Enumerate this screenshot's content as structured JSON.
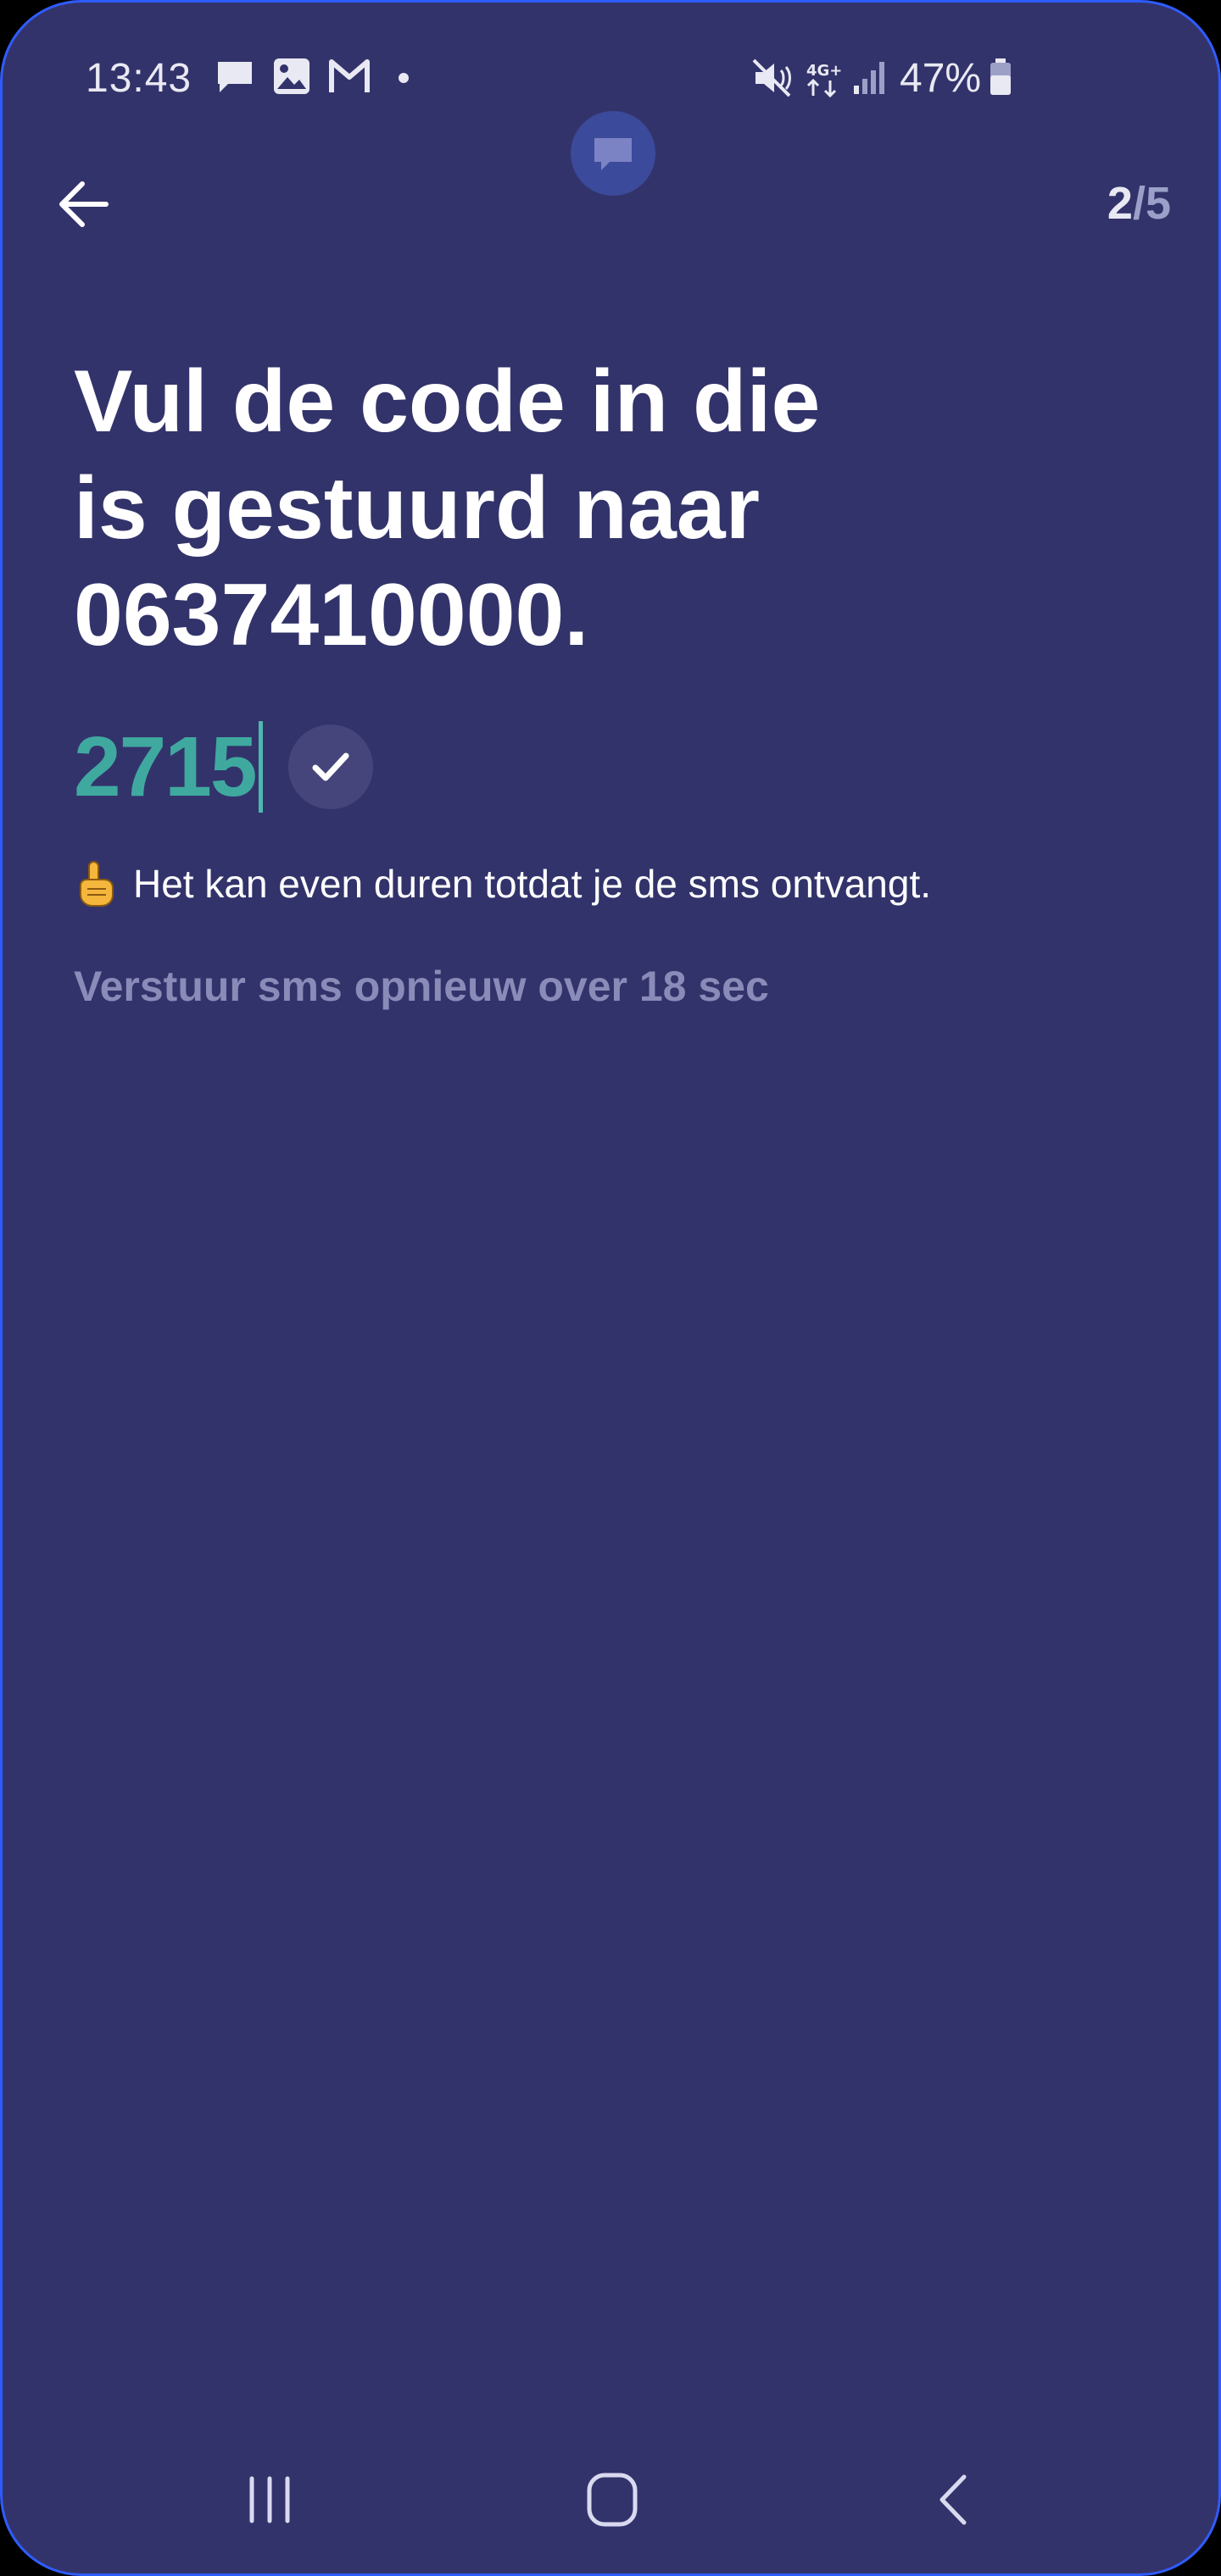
{
  "status_bar": {
    "time": "13:43",
    "network": "4G+",
    "battery": "47%",
    "left_icons": [
      "message-icon",
      "image-icon",
      "gmail-icon",
      "dot-icon"
    ],
    "right_icons": [
      "mute-icon",
      "network-4g-icon",
      "signal-icon",
      "battery-icon"
    ]
  },
  "header": {
    "step_current": "2",
    "step_separator": "/",
    "step_total": "5"
  },
  "main": {
    "title_line1": "Vul de code in die",
    "title_line2": "is gestuurd naar",
    "title_line3": "0637410000.",
    "code_value": "2715",
    "hint_text": "Het kan even duren totdat je de sms ontvangt.",
    "resend_text": "Verstuur sms opnieuw over 18 sec"
  },
  "colors": {
    "background": "#33336b",
    "code": "#3fa9a0",
    "muted": "#8a8bb8",
    "text": "#ffffff"
  }
}
